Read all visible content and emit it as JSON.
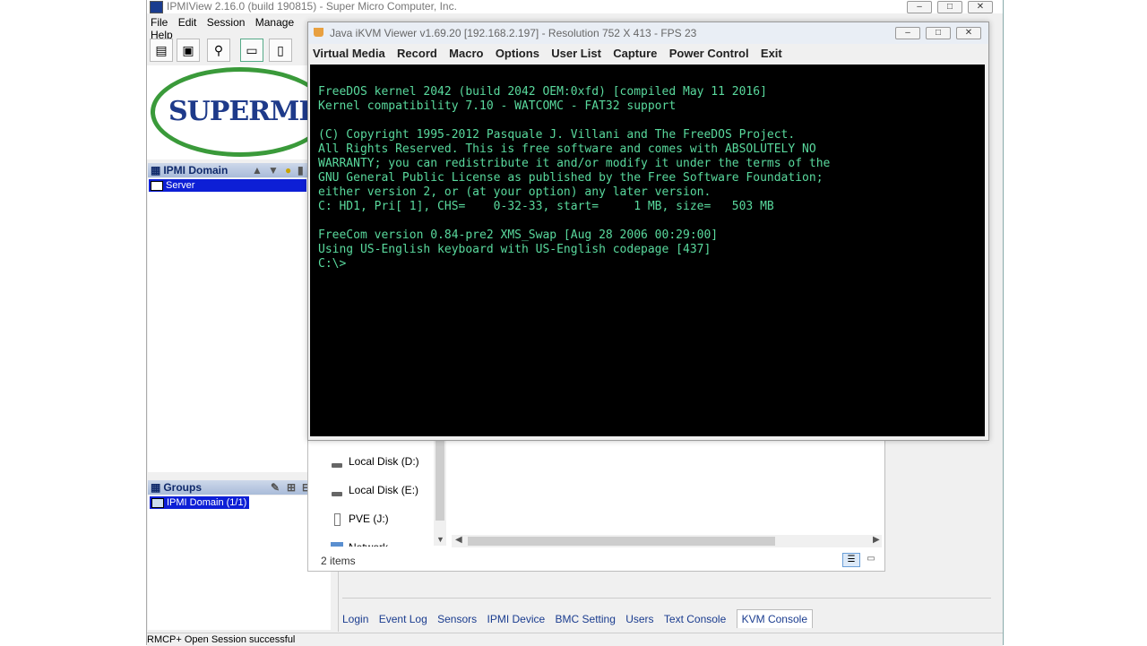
{
  "ipmiview": {
    "title": "IPMIView 2.16.0 (build 190815) - Super Micro Computer, Inc.",
    "menu": [
      "File",
      "Edit",
      "Session",
      "Manage",
      "Help"
    ],
    "logo_text": "SUPERMICRO",
    "tree_header": "IPMI Domain",
    "tree_selected": "Server",
    "groups_header": "Groups",
    "groups_item": "IPMI Domain (1/1)",
    "tabs": [
      "Login",
      "Event Log",
      "Sensors",
      "IPMI Device",
      "BMC Setting",
      "Users",
      "Text Console",
      "KVM Console"
    ],
    "active_tab": "KVM Console",
    "status": "RMCP+ Open Session successful"
  },
  "explorer": {
    "drives": [
      "Local Disk (D:)",
      "Local Disk (E:)",
      "PVE (J:)",
      "Network"
    ],
    "item_count": "2 items"
  },
  "kvm": {
    "title": "Java iKVM Viewer v1.69.20 [192.168.2.197]  - Resolution 752 X 413 - FPS 23",
    "menu": [
      "Virtual Media",
      "Record",
      "Macro",
      "Options",
      "User List",
      "Capture",
      "Power Control",
      "Exit"
    ],
    "console_lines": [
      "FreeDOS kernel 2042 (build 2042 OEM:0xfd) [compiled May 11 2016]",
      "Kernel compatibility 7.10 - WATCOMC - FAT32 support",
      "",
      "(C) Copyright 1995-2012 Pasquale J. Villani and The FreeDOS Project.",
      "All Rights Reserved. This is free software and comes with ABSOLUTELY NO",
      "WARRANTY; you can redistribute it and/or modify it under the terms of the",
      "GNU General Public License as published by the Free Software Foundation;",
      "either version 2, or (at your option) any later version.",
      "C: HD1, Pri[ 1], CHS=    0-32-33, start=     1 MB, size=   503 MB",
      "",
      "FreeCom version 0.84-pre2 XMS_Swap [Aug 28 2006 00:29:00]",
      "Using US-English keyboard with US-English codepage [437]",
      "C:\\>"
    ],
    "console_color": "#59d99d"
  }
}
